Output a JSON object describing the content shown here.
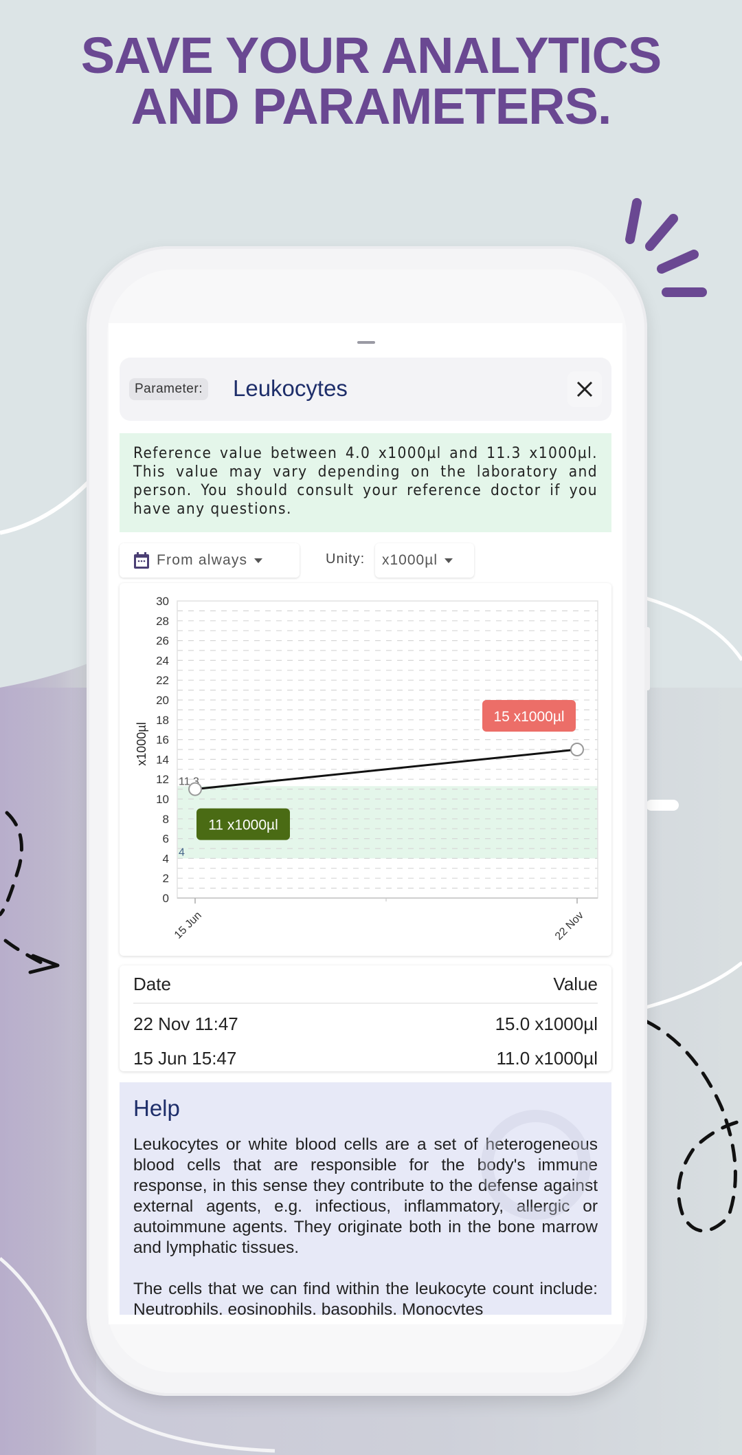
{
  "promo": {
    "headline_line1": "SAVE YOUR ANALYTICS",
    "headline_line2": "AND PARAMETERS.",
    "accent_color": "#6a4892"
  },
  "header": {
    "chip_label": "Parameter:",
    "parameter_name": "Leukocytes",
    "close_icon": "close-icon"
  },
  "reference": {
    "text": "Reference value between 4.0 x1000µl and 11.3 x1000µl. This value may vary depending on the laboratory and person. You should consult your reference doctor if you have any questions."
  },
  "filters": {
    "date_icon": "calendar-icon",
    "date_value": "From always",
    "unity_label": "Unity:",
    "unity_value": "x1000µl"
  },
  "chart_data": {
    "type": "line",
    "title": "",
    "xlabel": "",
    "ylabel": "x1000µl",
    "x": [
      "15 Jun",
      "22 Nov"
    ],
    "series": [
      {
        "name": "Leukocytes",
        "values": [
          11,
          15
        ]
      }
    ],
    "ylim": [
      0,
      30
    ],
    "yticks": [
      0,
      2,
      4,
      6,
      8,
      10,
      12,
      14,
      16,
      18,
      20,
      22,
      24,
      26,
      28,
      30
    ],
    "grid": true,
    "reference_range": {
      "low": 4,
      "high": 11.3,
      "low_label": "4",
      "high_label": "11.3",
      "color": "#e4f6ea"
    },
    "point_labels": [
      {
        "text": "11 x1000µl",
        "color": "#4a6b14"
      },
      {
        "text": "15 x1000µl",
        "color": "#ec6e68"
      }
    ]
  },
  "table": {
    "headers": {
      "date": "Date",
      "value": "Value"
    },
    "rows": [
      {
        "date": "22 Nov 11:47",
        "value": "15.0 x1000µl"
      },
      {
        "date": "15 Jun 15:47",
        "value": "11.0 x1000µl"
      }
    ]
  },
  "help": {
    "title": "Help",
    "paragraph1": "Leukocytes or white blood cells are a set of heterogeneous blood cells that are responsible for the body's immune response, in this sense they contribute to the defense against external agents, e.g. infectious, inflammatory, allergic or autoimmune agents. They originate both in the bone marrow and lymphatic tissues.",
    "paragraph2": "The cells that we can find within the leukocyte count include: Neutrophils, eosinophils, basophils, Monocytes"
  }
}
